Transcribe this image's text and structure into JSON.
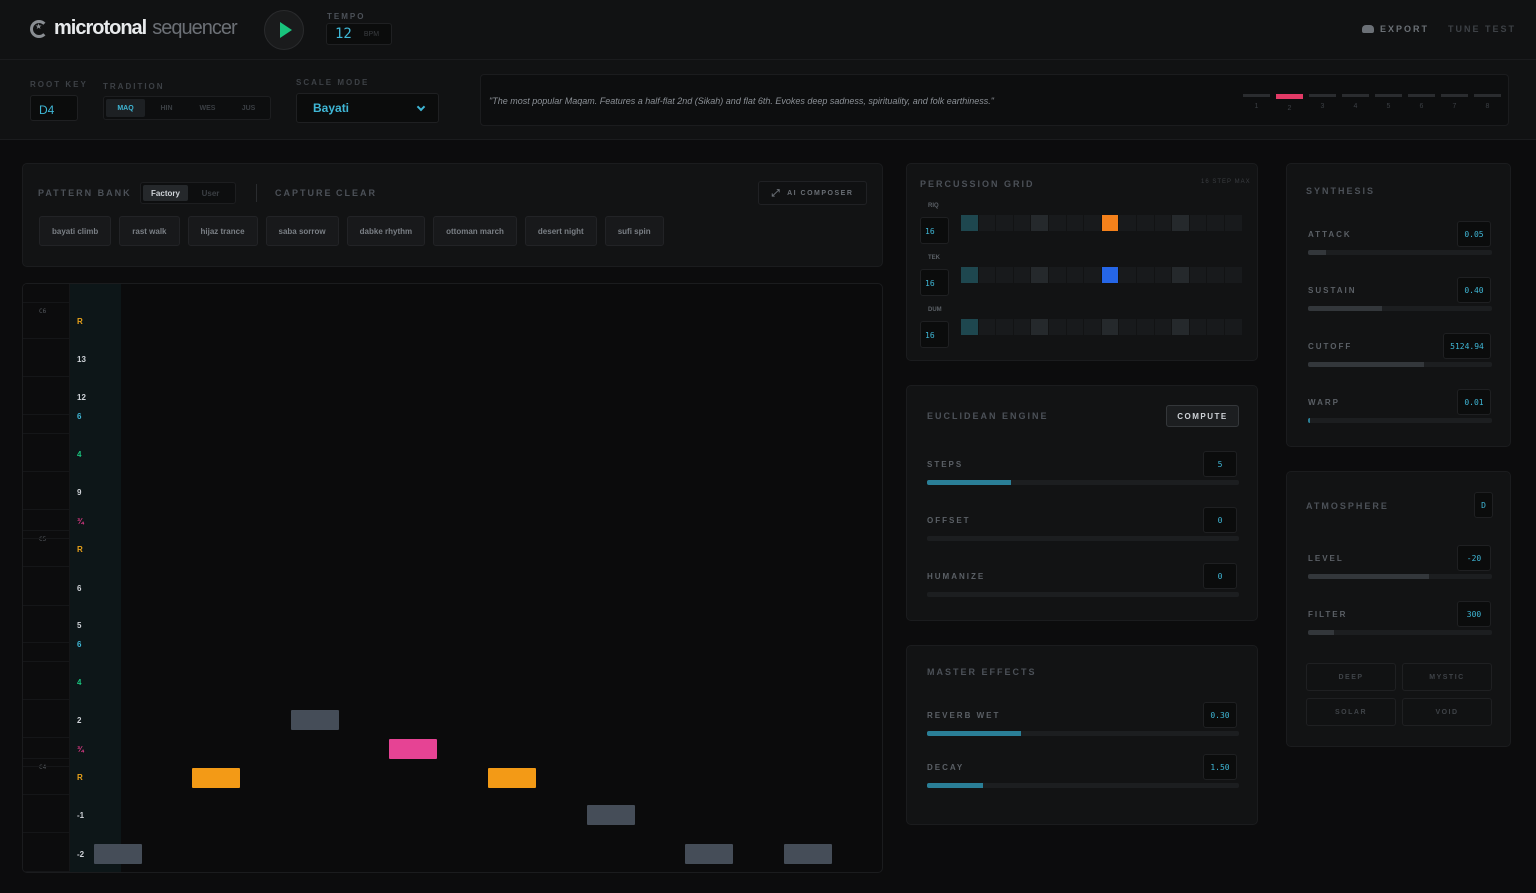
{
  "header": {
    "logo_primary": "microtonal",
    "logo_secondary": "sequencer",
    "tempo_label": "TEMPO",
    "tempo_value": "12",
    "tempo_unit": "BPM",
    "export_label": "EXPORT",
    "tune_test_label": "TUNE TEST"
  },
  "settings": {
    "root_key_label": "ROOT KEY",
    "root_key_value": "D4",
    "tradition_label": "TRADITION",
    "tradition_options": [
      "MAQ",
      "HIN",
      "WES",
      "JUS"
    ],
    "tradition_selected": "MAQ",
    "scale_mode_label": "SCALE MODE",
    "scale_mode_value": "Bayati",
    "description": "\"The most popular Maqam. Features a half-flat 2nd (Sikah) and flat 6th. Evokes deep sadness, spirituality, and folk earthiness.\"",
    "step_indicator": {
      "labels": [
        "1",
        "2",
        "3",
        "4",
        "5",
        "6",
        "7",
        "8"
      ],
      "active_index": 1,
      "active_color": "#e23a66"
    }
  },
  "pattern_bank": {
    "title": "PATTERN BANK",
    "tabs": [
      "Factory",
      "User"
    ],
    "selected_tab": "Factory",
    "capture_label": "CAPTURE",
    "clear_label": "CLEAR",
    "ai_composer_label": "AI COMPOSER",
    "presets": [
      "bayati climb",
      "rast walk",
      "hijaz trance",
      "saba sorrow",
      "dabke rhythm",
      "ottoman march",
      "desert night",
      "sufi spin"
    ]
  },
  "piano_roll": {
    "octave_labels": [
      "C6",
      "C5",
      "C4"
    ],
    "degree_labels": [
      {
        "text": "R",
        "color": "#e9a21a"
      },
      {
        "text": "13",
        "color": "#cfd3d8"
      },
      {
        "text": "12",
        "color": "#cfd3d8"
      },
      {
        "text": "6",
        "color": "#3fb7d6"
      },
      {
        "text": "4",
        "color": "#19c37d"
      },
      {
        "text": "9",
        "color": "#cfd3d8"
      },
      {
        "text": "¾",
        "color": "#e23a88"
      },
      {
        "text": "R",
        "color": "#e9a21a"
      },
      {
        "text": "6",
        "color": "#cfd3d8"
      },
      {
        "text": "5",
        "color": "#cfd3d8"
      },
      {
        "text": "6",
        "color": "#3fb7d6"
      },
      {
        "text": "4",
        "color": "#19c37d"
      },
      {
        "text": "2",
        "color": "#cfd3d8"
      },
      {
        "text": "¾",
        "color": "#e23a88"
      },
      {
        "text": "R",
        "color": "#e9a21a"
      },
      {
        "text": "-1",
        "color": "#cfd3d8"
      },
      {
        "text": "-2",
        "color": "#cfd3d8"
      }
    ],
    "note_colors": {
      "root": "#f39a16",
      "quarter": "#e64394",
      "other": "#454d58"
    }
  },
  "percussion": {
    "title": "PERCUSSION GRID",
    "max_label": "16 STEP MAX",
    "tracks": [
      {
        "name": "RIQ",
        "value": "16",
        "highlight_color": "#f4811b"
      },
      {
        "name": "TEK",
        "value": "16",
        "highlight_color": "#2566e8"
      },
      {
        "name": "DUM",
        "value": "16",
        "highlight_color": ""
      }
    ]
  },
  "euclidean": {
    "title": "EUCLIDEAN ENGINE",
    "compute_label": "COMPUTE",
    "params": [
      {
        "label": "STEPS",
        "value": "5",
        "fill": 0.27
      },
      {
        "label": "OFFSET",
        "value": "0",
        "fill": 0
      },
      {
        "label": "HUMANIZE",
        "value": "0",
        "fill": 0
      }
    ]
  },
  "master_effects": {
    "title": "MASTER EFFECTS",
    "params": [
      {
        "label": "REVERB WET",
        "value": "0.30",
        "fill": 0.3
      },
      {
        "label": "DECAY",
        "value": "1.50",
        "fill": 0.18
      }
    ]
  },
  "synthesis": {
    "title": "SYNTHESIS",
    "params": [
      {
        "label": "ATTACK",
        "value": "0.05",
        "fill": 0.1
      },
      {
        "label": "SUSTAIN",
        "value": "0.40",
        "fill": 0.4
      },
      {
        "label": "CUTOFF",
        "value": "5124.94",
        "fill": 0.63
      },
      {
        "label": "WARP",
        "value": "0.01",
        "fill": 0.01
      }
    ]
  },
  "atmosphere": {
    "title": "ATMOSPHERE",
    "key_value": "D",
    "params": [
      {
        "label": "LEVEL",
        "value": "-20",
        "fill": 0.66
      },
      {
        "label": "FILTER",
        "value": "300",
        "fill": 0.14
      }
    ],
    "presets": [
      "DEEP",
      "MYSTIC",
      "SOLAR",
      "VOID"
    ]
  },
  "colors": {
    "accent_cyan": "#3fb7d6",
    "play_green": "#19c37d",
    "background": "#0c0c0d"
  }
}
